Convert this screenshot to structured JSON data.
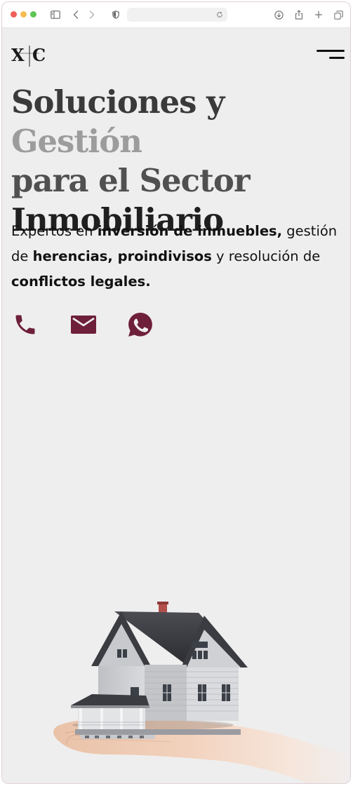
{
  "browser": {
    "traffic_lights": [
      "close",
      "minimize",
      "zoom"
    ],
    "icons": [
      "sidebar-icon",
      "back-icon",
      "forward-icon",
      "shield-icon",
      "reload-icon",
      "download-icon",
      "share-icon",
      "new-tab-icon",
      "tabs-overview-icon"
    ]
  },
  "site": {
    "logo_text": "X|C",
    "menu_icon": "hamburger-menu-icon"
  },
  "hero": {
    "title_part1": "Soluciones y ",
    "title_part2": "Gestión",
    "title_part3": "para el Sector",
    "title_part4": "Inmobiliario",
    "subtitle": {
      "t1": "Expertos en ",
      "b1": "inversión de inmuebles,",
      "t2": " gestión de ",
      "b2": "herencias, proindivisos",
      "t3": " y resolución de ",
      "b3": "conflictos legales."
    }
  },
  "contact_icons": [
    "phone-icon",
    "email-icon",
    "whatsapp-icon"
  ],
  "colors": {
    "accent": "#6e1f3a",
    "background": "#efeeee",
    "text": "#111111"
  }
}
